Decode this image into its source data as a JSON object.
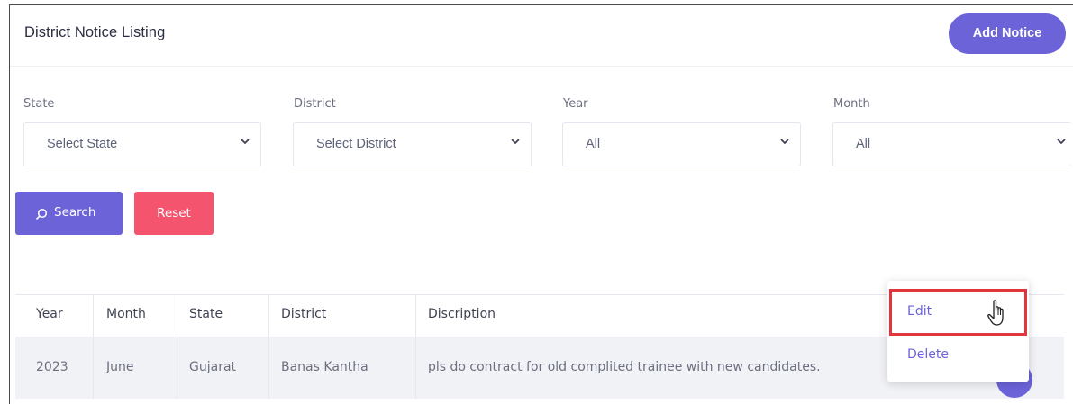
{
  "header": {
    "title": "District Notice Listing",
    "add_button": "Add Notice"
  },
  "filters": {
    "state": {
      "label": "State",
      "value": "Select State"
    },
    "district": {
      "label": "District",
      "value": "Select District"
    },
    "year": {
      "label": "Year",
      "value": "All"
    },
    "month": {
      "label": "Month",
      "value": "All"
    }
  },
  "actions": {
    "search": "Search",
    "reset": "Reset"
  },
  "table": {
    "columns": [
      "Year",
      "Month",
      "State",
      "District",
      "Discription"
    ],
    "rows": [
      [
        "2023",
        "June",
        "Gujarat",
        "Banas Kantha",
        "pls do contract for old complited trainee with new candidates."
      ]
    ]
  },
  "row_menu": {
    "edit": "Edit",
    "delete": "Delete"
  },
  "colors": {
    "primary": "#6c63d9",
    "danger": "#f4546e",
    "highlight": "#e0363e"
  }
}
